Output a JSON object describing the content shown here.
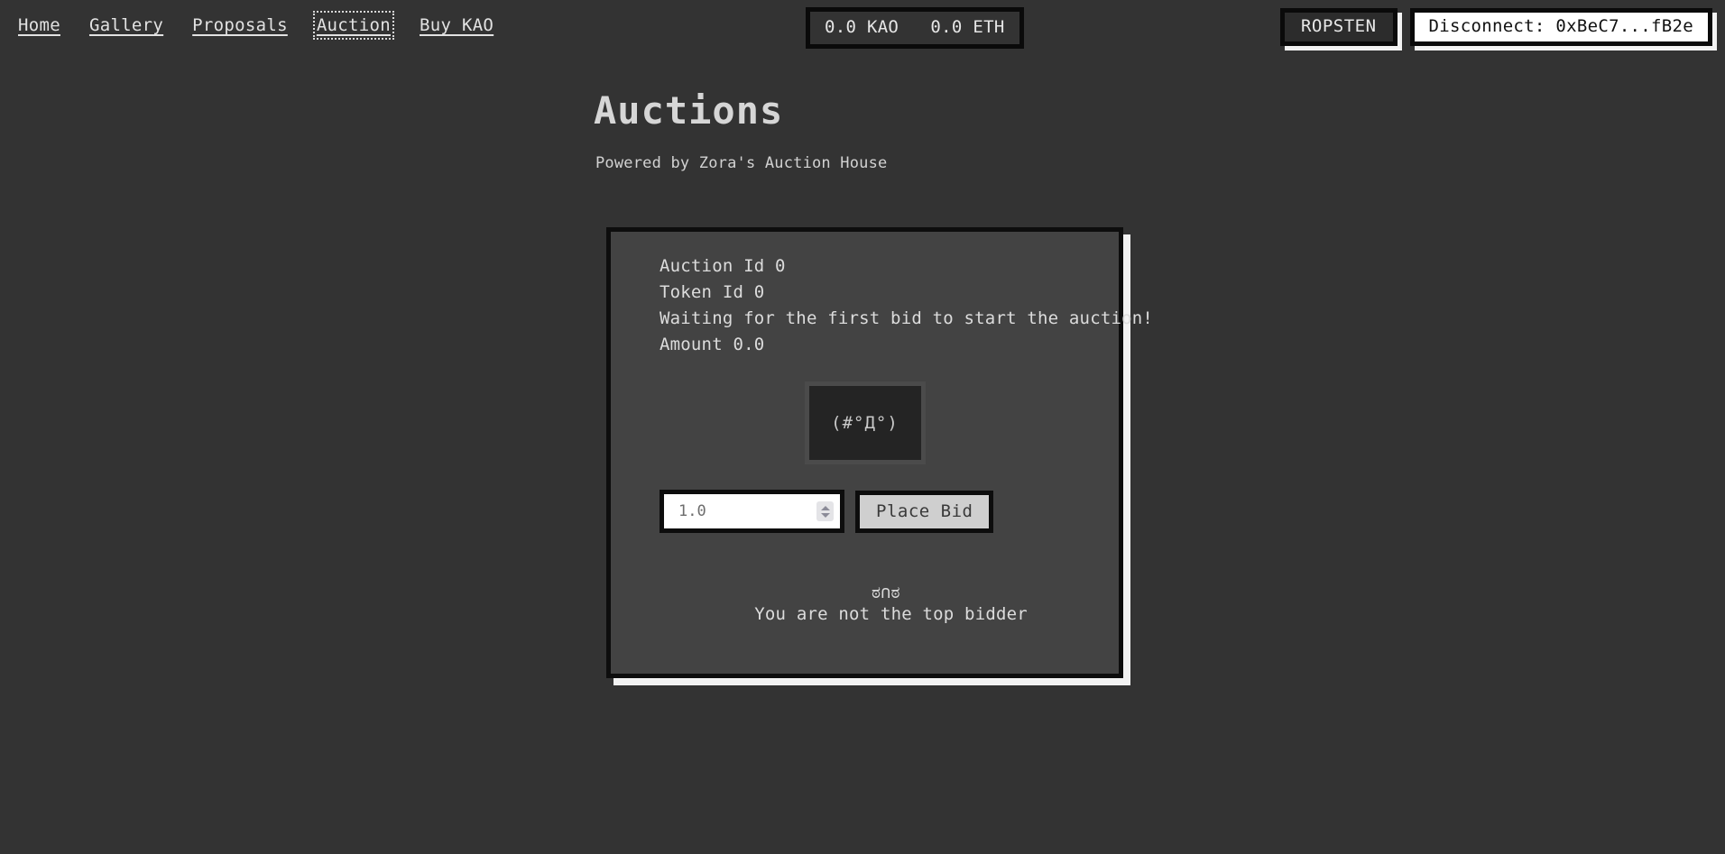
{
  "nav": {
    "links": [
      {
        "label": "Home",
        "focused": false
      },
      {
        "label": "Gallery",
        "focused": false
      },
      {
        "label": "Proposals",
        "focused": false
      },
      {
        "label": "Auction",
        "focused": true
      },
      {
        "label": "Buy KAO",
        "focused": false
      }
    ]
  },
  "balance": {
    "text": "0.0 KAO   0.0 ETH",
    "token_amount": "0.0",
    "token_symbol": "KAO",
    "eth_amount": "0.0",
    "eth_symbol": "ETH"
  },
  "wallet": {
    "network_label": "ROPSTEN",
    "disconnect_label": "Disconnect: 0xBeC7...fB2e",
    "address_short": "0xBeC7...fB2e"
  },
  "page": {
    "title": "Auctions",
    "subtitle": "Powered by Zora's Auction House"
  },
  "auction": {
    "auction_id_line": "Auction Id 0",
    "token_id_line": "Token Id 0",
    "waiting_line": "Waiting for the first bid to start the auction!",
    "amount_line": "Amount 0.0",
    "media_placeholder": "(#°Д°)",
    "bid_input_value": "1.0",
    "bid_input_placeholder": "1.0",
    "place_bid_label": "Place Bid",
    "status_emoticon": "ಠ∩ಠ",
    "status_text": "You are not the top bidder"
  },
  "colors": {
    "page_background": "#333333",
    "card_background": "#434343",
    "card_border": "#0d0d0d",
    "card_shadow": "#f2f2f2",
    "text_primary": "#dcdcdc",
    "button_light": "#cfcfcf",
    "button_dark": "#2c2c2c",
    "media_fill": "#242424"
  }
}
